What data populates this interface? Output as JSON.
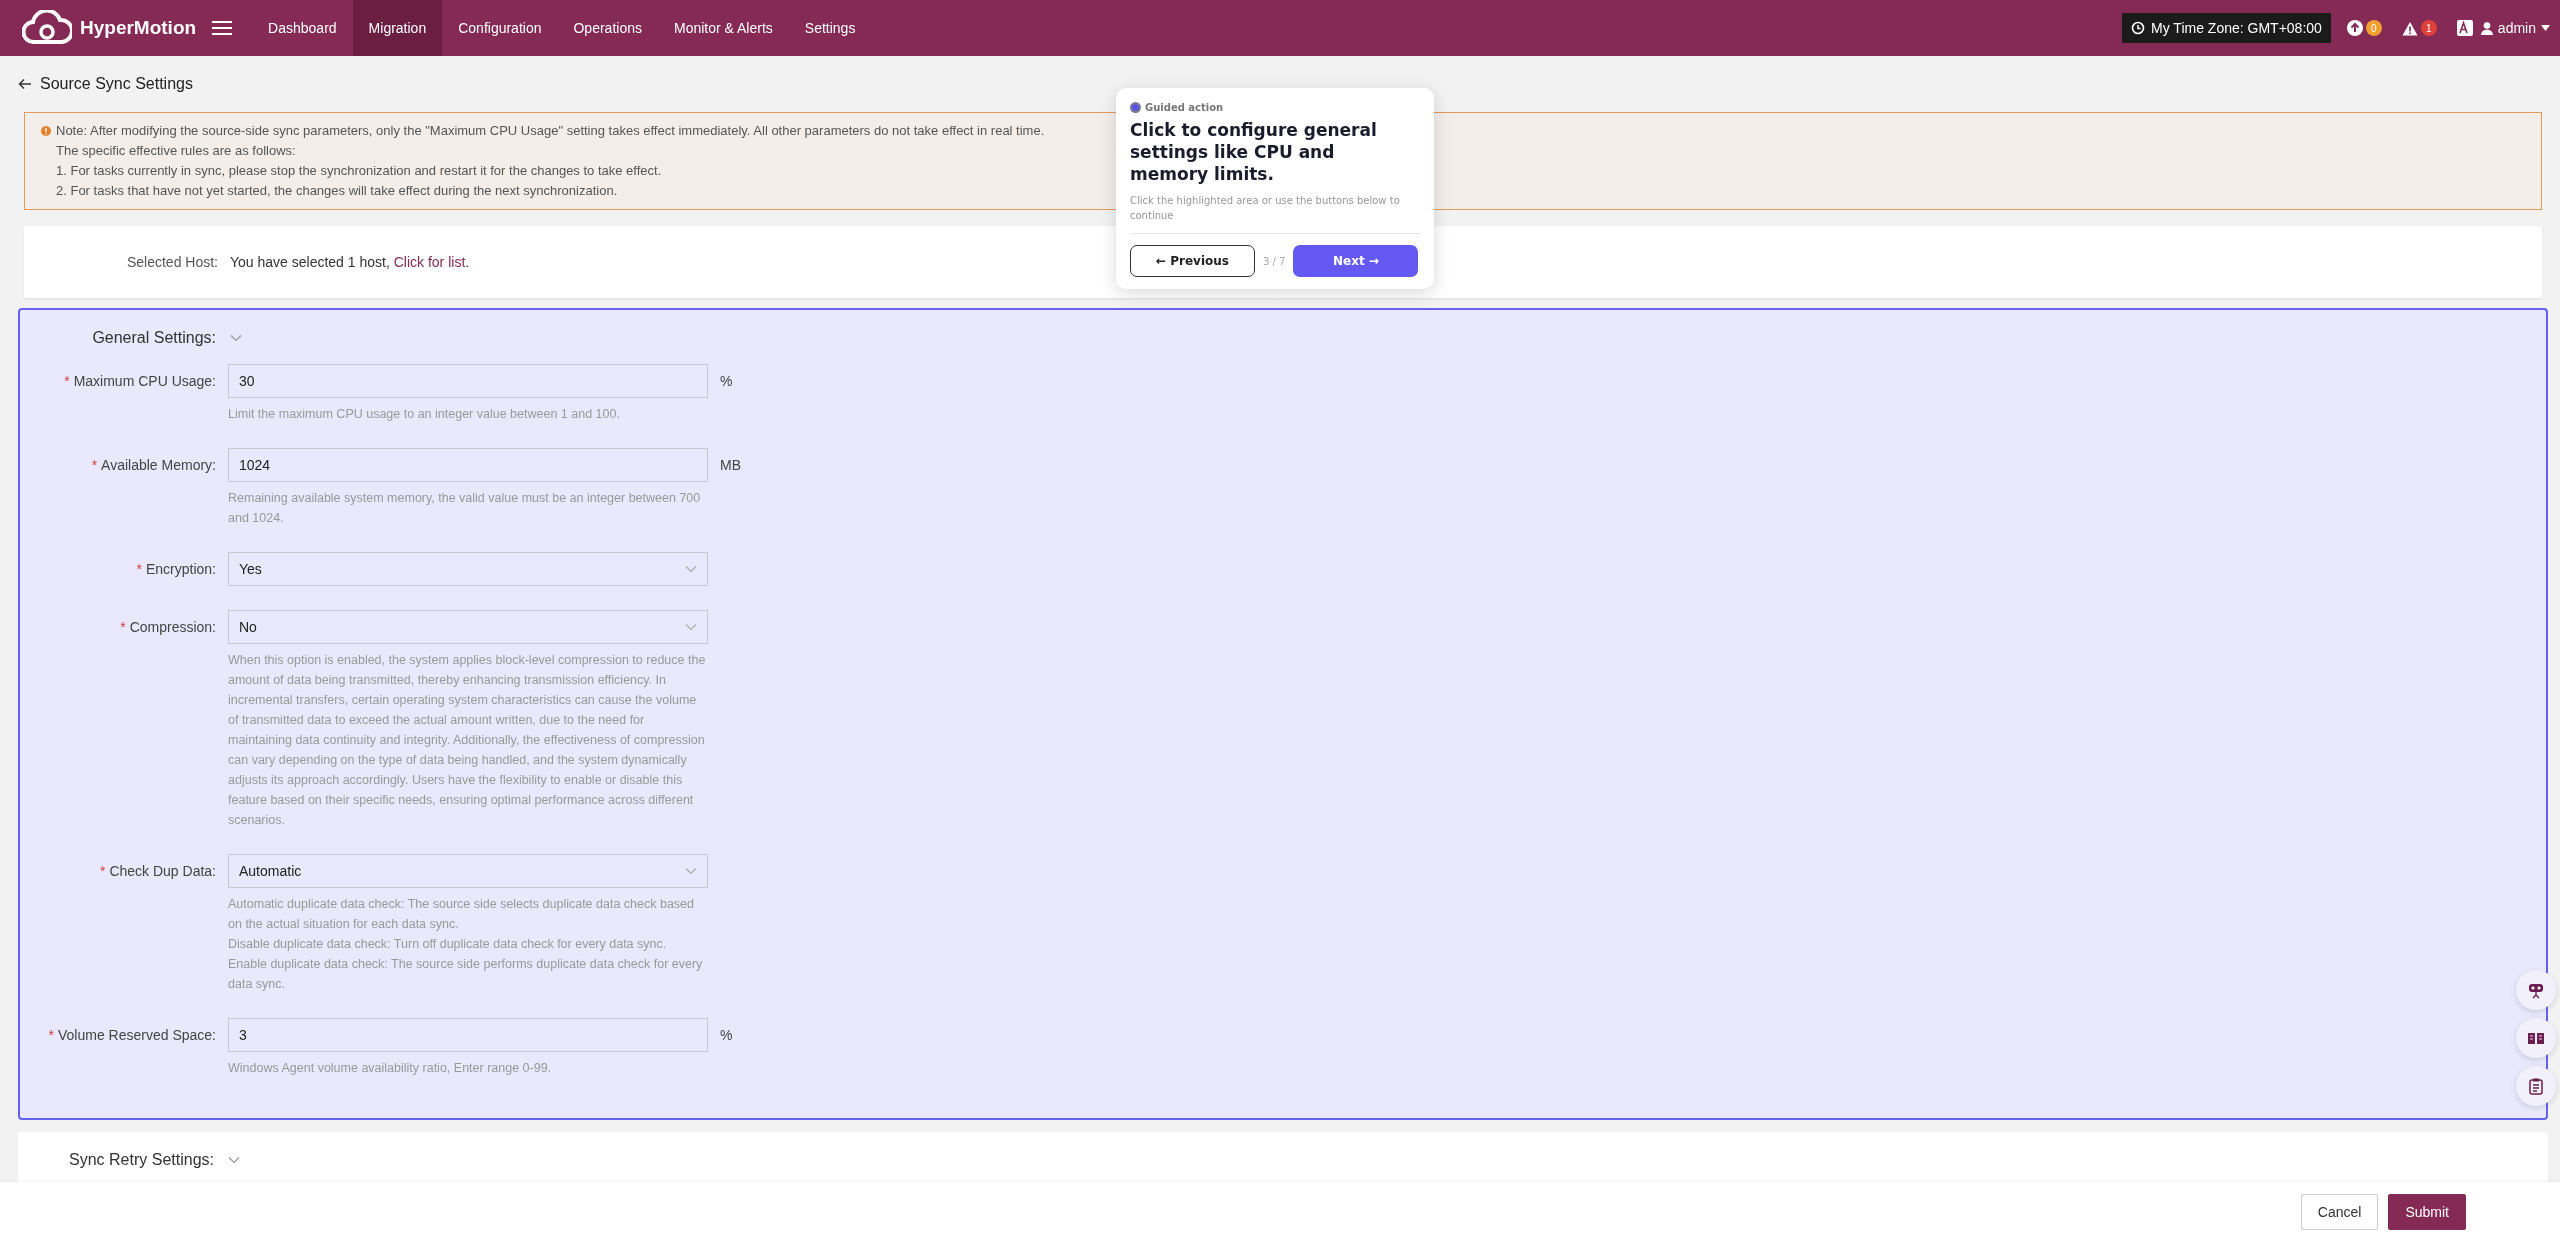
{
  "app": {
    "name": "HyperMotion"
  },
  "nav": [
    {
      "label": "Dashboard",
      "selected": false
    },
    {
      "label": "Migration",
      "selected": true
    },
    {
      "label": "Configuration",
      "selected": false
    },
    {
      "label": "Operations",
      "selected": false
    },
    {
      "label": "Monitor & Alerts",
      "selected": false
    },
    {
      "label": "Settings",
      "selected": false
    }
  ],
  "header": {
    "timezone": "My Time Zone: GMT+08:00",
    "upload_badge": "0",
    "alert_badge": "1",
    "user": "admin"
  },
  "page": {
    "title": "Source Sync Settings"
  },
  "note": {
    "lines": [
      "Note: After modifying the source-side sync parameters, only the \"Maximum CPU Usage\" setting takes effect immediately. All other parameters do not take effect in real time.",
      "The specific effective rules are as follows:",
      "1. For tasks currently in sync, please stop the synchronization and restart it for the changes to take effect.",
      "2. For tasks that have not yet started, the changes will take effect during the next synchronization."
    ]
  },
  "host": {
    "label": "Selected Host:",
    "text": "You have selected 1 host, ",
    "link": "Click for list",
    "suffix": "."
  },
  "sections": [
    {
      "title": "General Settings:",
      "highlighted": true,
      "fields": [
        {
          "kind": "input",
          "required_mark": "*",
          "label": "Maximum CPU Usage:",
          "value": "30",
          "unit": "%",
          "help": [
            "Limit the maximum CPU usage to an integer value between 1 and 100."
          ]
        },
        {
          "kind": "input",
          "required_mark": "*",
          "label": "Available Memory:",
          "value": "1024",
          "unit": "MB",
          "help": [
            "Remaining available system memory, the valid value must be an integer between 700 and 1024."
          ]
        },
        {
          "kind": "select",
          "required_mark": "*",
          "label": "Encryption:",
          "value": "Yes"
        },
        {
          "kind": "select",
          "required_mark": "*",
          "label": "Compression:",
          "value": "No",
          "help": [
            "When this option is enabled, the system applies block-level compression to reduce the amount of data being transmitted, thereby enhancing transmission efficiency. In incremental transfers, certain operating system characteristics can cause the volume of transmitted data to exceed the actual amount written, due to the need for maintaining data continuity and integrity. Additionally, the effectiveness of compression can vary depending on the type of data being handled, and the system dynamically adjusts its approach accordingly. Users have the flexibility to enable or disable this feature based on their specific needs, ensuring optimal performance across different scenarios."
          ]
        },
        {
          "kind": "select",
          "required_mark": "*",
          "label": "Check Dup Data:",
          "value": "Automatic",
          "help": [
            "Automatic duplicate data check: The source side selects duplicate data check based on the actual situation for each data sync.",
            "Disable duplicate data check: Turn off duplicate data check for every data sync.",
            "Enable duplicate data check: The source side performs duplicate data check for every data sync."
          ]
        },
        {
          "kind": "input",
          "required_mark": "*",
          "label": "Volume Reserved Space:",
          "value": "3",
          "unit": "%",
          "help": [
            "Windows Agent volume availability ratio, Enter range 0-99."
          ]
        }
      ]
    },
    {
      "title": "Sync Retry Settings:",
      "highlighted": false
    }
  ],
  "guide": {
    "tag": "Guided action",
    "title": "Click to configure general settings like CPU and memory limits.",
    "hint": "Click the highlighted area or use the buttons below to continue",
    "step": "3 / 7",
    "prev": "← Previous",
    "next": "Next →"
  },
  "footer": {
    "buttons": [
      {
        "label": "Cancel",
        "kind": "secondary"
      },
      {
        "label": "Submit",
        "kind": "primary"
      }
    ]
  }
}
